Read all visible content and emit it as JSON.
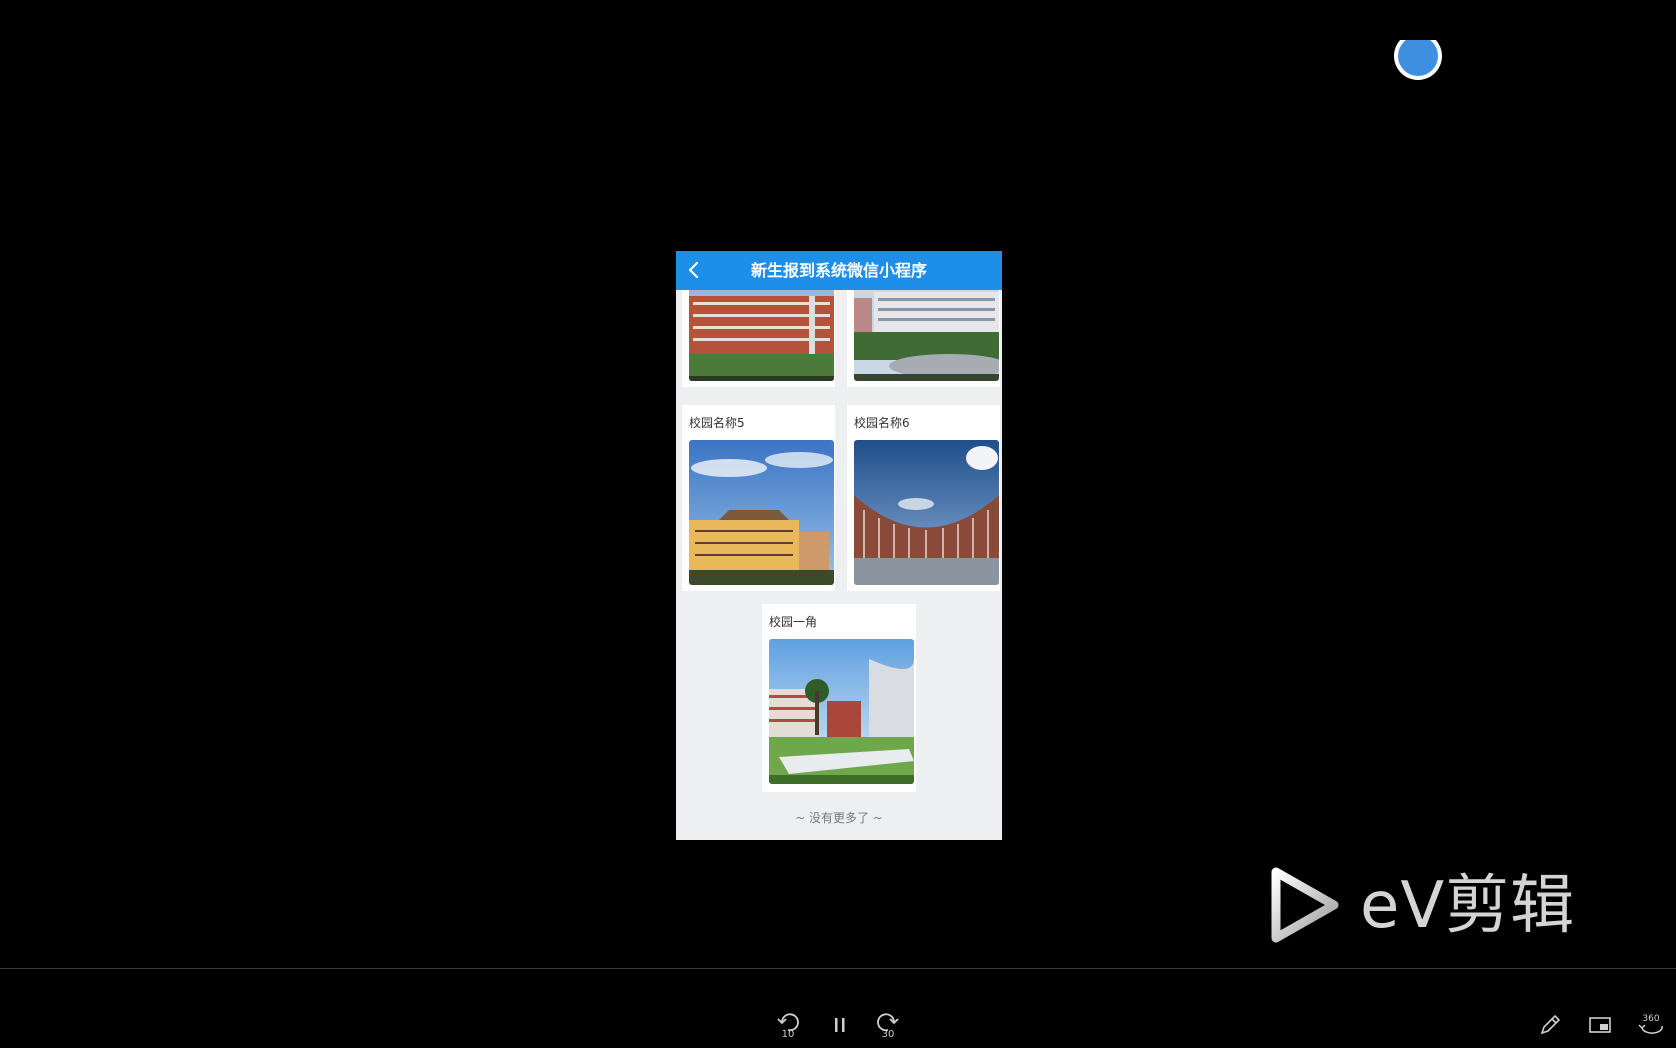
{
  "app": {
    "title": "新生报到系统微信小程序",
    "back_icon": "chevron-left-icon"
  },
  "cards": [
    {
      "label": "",
      "image": "campus-brick-building"
    },
    {
      "label": "",
      "image": "campus-building-lawn"
    },
    {
      "label": "校园名称5",
      "image": "campus-yellow-building-sky"
    },
    {
      "label": "校园名称6",
      "image": "campus-curved-building"
    },
    {
      "label": "校园一角",
      "image": "campus-courtyard-tree"
    }
  ],
  "footer": {
    "no_more": "~ 没有更多了 ~"
  },
  "watermark": {
    "text": "eV剪辑",
    "icon": "play-logo-icon"
  },
  "player": {
    "rewind_label": "10",
    "forward_label": "30",
    "pause_icon": "pause-icon",
    "pen_icon": "pen-icon",
    "pip_icon": "picture-in-picture-icon",
    "rotate_label": "360"
  },
  "colors": {
    "nav_bg": "#1d8fe8",
    "page_bg": "#eeeff1",
    "background": "#000000"
  }
}
